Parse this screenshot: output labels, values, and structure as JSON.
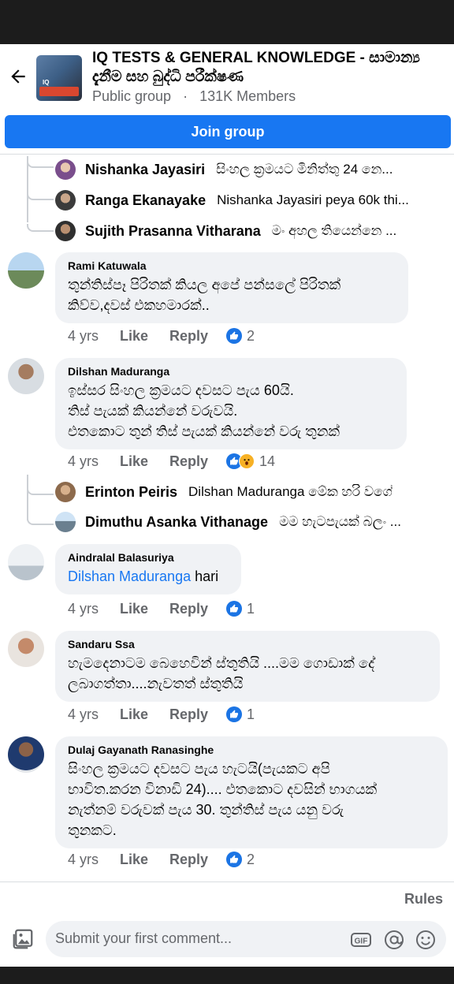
{
  "header": {
    "title": "IQ  TESTS &  GENERAL KNOWLEDGE - සාමාන්‍ය දැනීම සහ බුද්ධි පරීක්ෂණ",
    "privacy": "Public group",
    "separator": "·",
    "members": "131K Members",
    "join_label": "Join group"
  },
  "top_replies": [
    {
      "name": "Nishanka Jayasiri",
      "text": "සිංහල ක්‍රමයට මිනිත්තු 24 නෙ..."
    },
    {
      "name": "Ranga Ekanayake",
      "text": "Nishanka Jayasiri  peya 60k thi..."
    },
    {
      "name": "Sujith Prasanna Vitharana",
      "text": "මං අහල තියෙන්නෙ ..."
    }
  ],
  "comments": [
    {
      "author": "Rami Katuwala",
      "lines": [
        "තුන්තිස්පෑ පිරිතක් කියල අපේ පන්සලේ පිරිතක්",
        "කිව්ව,දවස් එකහමාරක්.."
      ],
      "time": "4 yrs",
      "like": "Like",
      "reply": "Reply",
      "count": "2"
    },
    {
      "author": "Dilshan Maduranga",
      "lines": [
        "ඉස්සර සිංහල ක්‍රමයට දවසට පැය 60යි.",
        "තිස් පැයක් කියන්නේ වරුවයි.",
        "එතකොට තුන් තිස් පැයක් කියන්නේ වරු තුනක්"
      ],
      "time": "4 yrs",
      "like": "Like",
      "reply": "Reply",
      "count": "14"
    },
    {
      "author": "Aindralal Balasuriya",
      "mention": "Dilshan Maduranga",
      "text": " hari",
      "time": "4 yrs",
      "like": "Like",
      "reply": "Reply",
      "count": "1"
    },
    {
      "author": "Sandaru Ssa",
      "lines": [
        "හැමදෙනාටම බෙහෙවින් ස්තුතියි ....මම ගොඩාක් දේ",
        "ලබාගත්තා....නැවතත් ස්තුතියි"
      ],
      "time": "4 yrs",
      "like": "Like",
      "reply": "Reply",
      "count": "1"
    },
    {
      "author": "Dulaj Gayanath Ranasinghe",
      "lines": [
        "සිංහල ක්‍රමයට දවසට පැය හැටයි(පැයකට අපි",
        "භාවිත.කරන විනාඩි 24).... එතකොට දවසින් භාගයක්",
        "නැත්නම් වරුවක් පැය 30. තුන්තිස් පැය යනු වරු",
        "තුනකට."
      ],
      "time": "4 yrs",
      "like": "Like",
      "reply": "Reply",
      "count": "2"
    }
  ],
  "mid_replies": [
    {
      "name": "Erinton Peiris",
      "text": "Dilshan Maduranga  මේක හරි වගේ"
    },
    {
      "name": "Dimuthu Asanka Vithanage",
      "text": "මම හැටපැයක් බලං ..."
    }
  ],
  "footer": {
    "rules": "Rules",
    "composer_placeholder": "Submit your first comment...",
    "gif": "GIF"
  },
  "colors": {
    "accent": "#1877f2",
    "bubble": "#f0f2f5",
    "muted": "#65676b"
  }
}
